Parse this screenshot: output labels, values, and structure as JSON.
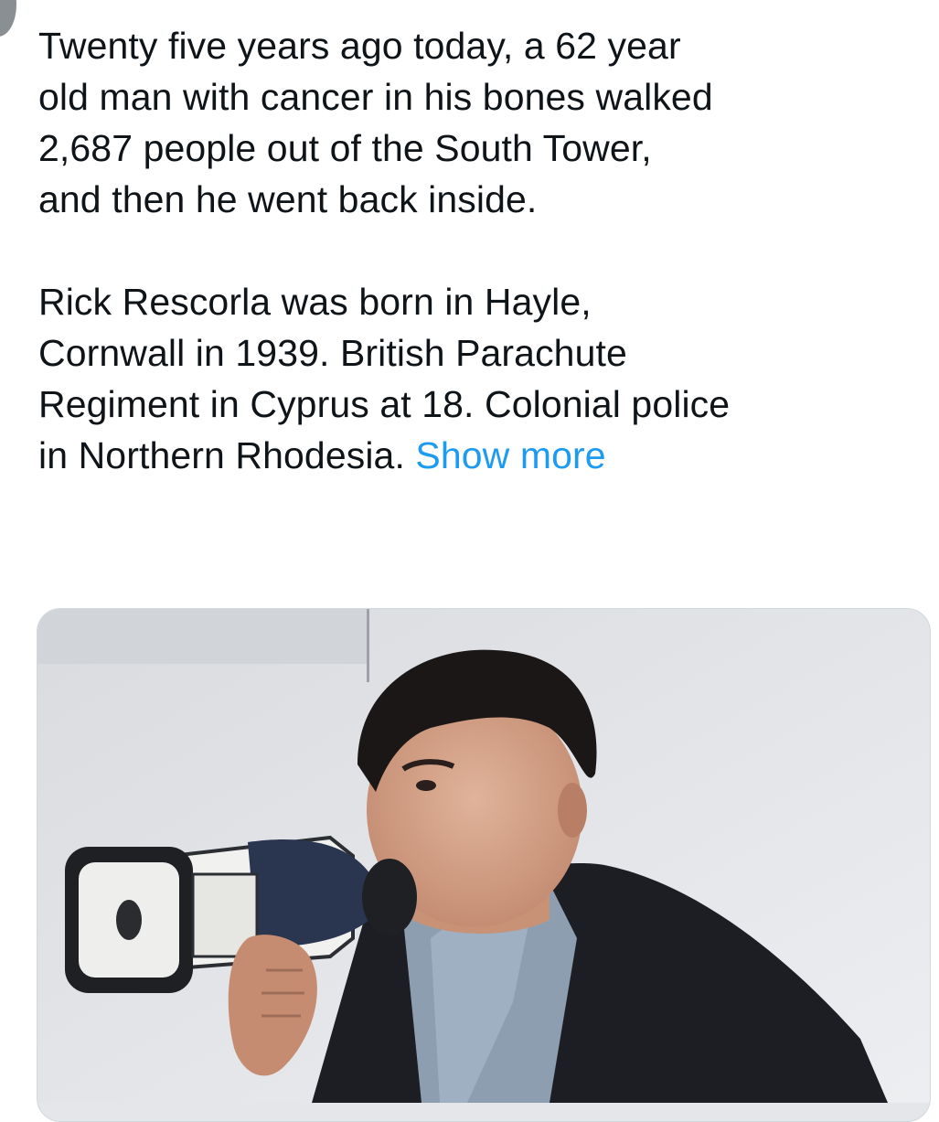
{
  "tweet": {
    "paragraph_1": "Twenty five years ago today, a 62 year\nold man with cancer in his bones walked\n2,687 people out of the South Tower,\nand then he went back inside.",
    "paragraph_2": "Rick Rescorla was born in Hayle,\nCornwall in 1939. British Parachute\nRegiment in Cyprus at 18. Colonial police\nin Northern Rhodesia. ",
    "show_more_label": "Show more",
    "show_more_color": "#1d9bf0"
  },
  "media": {
    "icon": "photo-icon",
    "subject": "man in dark blazer speaking into a megaphone"
  }
}
